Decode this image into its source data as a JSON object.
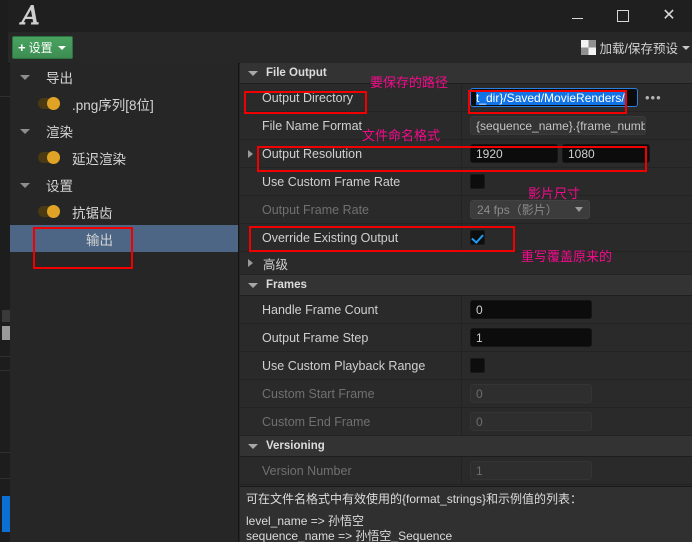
{
  "window": {
    "logo_glyph": "ᵊ4",
    "minimize_label": "",
    "maximize_label": "",
    "close_label": "✕"
  },
  "toolbar": {
    "settings_button": "设置",
    "settings_plus": "+",
    "preset_button": "加载/保存预设"
  },
  "sidebar": {
    "items": [
      {
        "label": "导出",
        "type": "group",
        "expanded": true,
        "selected": false
      },
      {
        "label": ".png序列[8位]",
        "type": "toggle",
        "enabled": true,
        "selected": false
      },
      {
        "label": "渲染",
        "type": "group",
        "expanded": true,
        "selected": false
      },
      {
        "label": "延迟渲染",
        "type": "toggle",
        "enabled": true,
        "selected": false
      },
      {
        "label": "设置",
        "type": "group",
        "expanded": true,
        "selected": false
      },
      {
        "label": "抗锯齿",
        "type": "toggle",
        "enabled": true,
        "selected": false
      },
      {
        "label": "输出",
        "type": "leaf",
        "selected": true
      }
    ]
  },
  "details": {
    "sections": [
      {
        "id": "file_output",
        "title": "File Output",
        "expanded": true,
        "rows": [
          {
            "name": "Output Directory",
            "kind": "text",
            "value": "t_dir}/Saved/MovieRenders/",
            "focused": true,
            "has_browse": true,
            "browse_label": "•••",
            "disabled": false
          },
          {
            "name": "File Name Format",
            "kind": "text-grey",
            "value": "{sequence_name}.{frame_numbe",
            "focused": false,
            "disabled": false
          },
          {
            "name": "Output Resolution",
            "kind": "vector2",
            "expandable": true,
            "value_x": "1920",
            "value_y": "1080",
            "disabled": false
          },
          {
            "name": "Use Custom Frame Rate",
            "kind": "checkbox",
            "checked": false,
            "disabled": false
          },
          {
            "name": "Output Frame Rate",
            "kind": "combo",
            "value": "24 fps（影片）",
            "disabled": true
          },
          {
            "name": "Override Existing Output",
            "kind": "checkbox",
            "checked": true,
            "disabled": false
          }
        ],
        "sub_group": {
          "label": "高级",
          "expanded": false
        }
      },
      {
        "id": "frames",
        "title": "Frames",
        "expanded": true,
        "rows": [
          {
            "name": "Handle Frame Count",
            "kind": "number",
            "value": "0",
            "disabled": false
          },
          {
            "name": "Output Frame Step",
            "kind": "number",
            "value": "1",
            "disabled": false
          },
          {
            "name": "Use Custom Playback Range",
            "kind": "checkbox",
            "checked": false,
            "disabled": false
          },
          {
            "name": "Custom Start Frame",
            "kind": "number",
            "value": "0",
            "disabled": true
          },
          {
            "name": "Custom End Frame",
            "kind": "number",
            "value": "0",
            "disabled": true
          }
        ]
      },
      {
        "id": "versioning",
        "title": "Versioning",
        "expanded": true,
        "rows": [
          {
            "name": "Version Number",
            "kind": "number",
            "value": "1",
            "disabled": true
          }
        ]
      }
    ]
  },
  "tooltip": {
    "line1": "可在文件名格式中有效使用的{format_strings}和示例值的列表：",
    "line2": "level_name => 孙悟空",
    "line3": "sequence_name => 孙悟空_Sequence"
  },
  "annotations": {
    "color_box": "#f00000",
    "color_text": "#f50a8c",
    "notes": [
      {
        "text": "要保存的路径",
        "target": "output-directory"
      },
      {
        "text": "文件命名格式",
        "target": "file-name-format"
      },
      {
        "text": "影片尺寸",
        "target": "output-resolution"
      },
      {
        "text": "重写覆盖原来的",
        "target": "override-existing-output"
      }
    ]
  }
}
